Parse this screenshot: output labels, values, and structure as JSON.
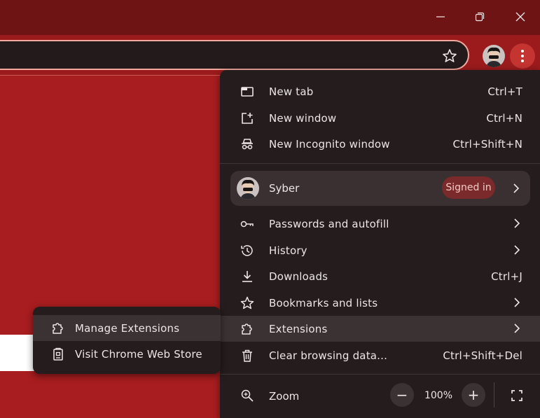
{
  "window_controls": {
    "minimize": "minimize-icon",
    "restore": "restore-icon",
    "close": "close-icon"
  },
  "toolbar": {
    "bookmark_icon": "star-icon",
    "menu_icon": "three-dots-vertical-icon"
  },
  "menu": {
    "items_top": [
      {
        "label": "New tab",
        "shortcut": "Ctrl+T",
        "icon": "new-tab-icon"
      },
      {
        "label": "New window",
        "shortcut": "Ctrl+N",
        "icon": "new-window-icon"
      },
      {
        "label": "New Incognito window",
        "shortcut": "Ctrl+Shift+N",
        "icon": "incognito-icon"
      }
    ],
    "profile": {
      "name": "Syber",
      "status": "Signed in"
    },
    "items_mid": [
      {
        "label": "Passwords and autofill",
        "icon": "key-icon"
      },
      {
        "label": "History",
        "icon": "history-icon"
      },
      {
        "label": "Downloads",
        "shortcut": "Ctrl+J",
        "icon": "download-icon"
      },
      {
        "label": "Bookmarks and lists",
        "icon": "star-icon"
      },
      {
        "label": "Extensions",
        "icon": "puzzle-icon"
      },
      {
        "label": "Clear browsing data...",
        "shortcut": "Ctrl+Shift+Del",
        "icon": "trash-icon"
      }
    ],
    "zoom": {
      "label": "Zoom",
      "minus": "−",
      "value": "100%",
      "plus": "+"
    }
  },
  "submenu": {
    "items": [
      {
        "label": "Manage Extensions",
        "icon": "puzzle-icon"
      },
      {
        "label": "Visit Chrome Web Store",
        "icon": "web-store-icon"
      }
    ]
  },
  "colors": {
    "accent": "#a81d1f",
    "titlebar": "#6e1415",
    "menu_bg": "#241c1d",
    "badge": "#7a2a2a"
  }
}
